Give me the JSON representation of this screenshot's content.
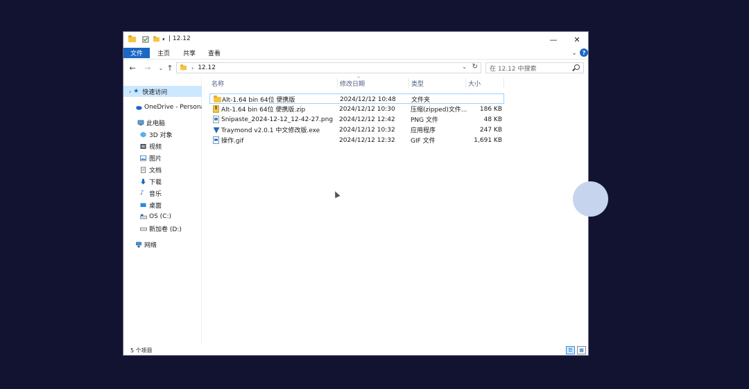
{
  "window": {
    "title": "12.12",
    "title_sep": "|",
    "close": "✕",
    "minimize": "—",
    "ribbon_collapse": "⌄",
    "help": "?"
  },
  "ribbon": {
    "tabs": [
      {
        "label": "文件",
        "active": true
      },
      {
        "label": "主页",
        "active": false
      },
      {
        "label": "共享",
        "active": false
      },
      {
        "label": "查看",
        "active": false
      }
    ]
  },
  "nav": {
    "back": "←",
    "forward": "→",
    "recent": "⌄",
    "up": "↑",
    "path_sep": "›",
    "path": "12.12",
    "path_dropdown": "⌄",
    "refresh": "↻",
    "search_placeholder": "在 12.12 中搜索"
  },
  "sidebar": {
    "items": [
      {
        "label": "快速访问",
        "icon": "star-icon",
        "selected": true
      },
      {
        "label": "OneDrive - Persona",
        "icon": "cloud-icon",
        "selected": false
      },
      {
        "label": "此电脑",
        "icon": "computer-icon",
        "selected": false
      },
      {
        "label": "3D 对象",
        "icon": "cube-icon",
        "selected": false
      },
      {
        "label": "视频",
        "icon": "video-icon",
        "selected": false
      },
      {
        "label": "图片",
        "icon": "picture-icon",
        "selected": false
      },
      {
        "label": "文档",
        "icon": "document-icon",
        "selected": false
      },
      {
        "label": "下载",
        "icon": "download-icon",
        "selected": false
      },
      {
        "label": "音乐",
        "icon": "music-icon",
        "selected": false
      },
      {
        "label": "桌面",
        "icon": "desktop-icon",
        "selected": false
      },
      {
        "label": "OS (C:)",
        "icon": "drive-icon",
        "selected": false
      },
      {
        "label": "新加卷 (D:)",
        "icon": "drive-icon",
        "selected": false
      },
      {
        "label": "网络",
        "icon": "network-icon",
        "selected": false
      }
    ]
  },
  "columns": {
    "name": "名称",
    "date": "修改日期",
    "type": "类型",
    "size": "大小",
    "sort_indicator": "^"
  },
  "files": [
    {
      "name": "Alt-1.64 bin 64位 便携版",
      "date": "2024/12/12 10:48",
      "type": "文件夹",
      "size": "",
      "icon": "folder-icon",
      "selected": true
    },
    {
      "name": "Alt-1.64 bin 64位 便携版.zip",
      "date": "2024/12/12 10:30",
      "type": "压缩(zipped)文件...",
      "size": "186 KB",
      "icon": "zip-icon",
      "selected": false
    },
    {
      "name": "Snipaste_2024-12-12_12-42-27.png",
      "date": "2024/12/12 12:42",
      "type": "PNG 文件",
      "size": "48 KB",
      "icon": "png-icon",
      "selected": false
    },
    {
      "name": "Traymond v2.0.1 中文修改版.exe",
      "date": "2024/12/12 10:32",
      "type": "应用程序",
      "size": "247 KB",
      "icon": "exe-icon",
      "selected": false
    },
    {
      "name": "操作.gif",
      "date": "2024/12/12 12:32",
      "type": "GIF 文件",
      "size": "1,691 KB",
      "icon": "gif-icon",
      "selected": false
    }
  ],
  "status": {
    "item_count": "5 个项目"
  },
  "colors": {
    "background": "#121231",
    "accent": "#1a67c4",
    "selection": "#cce8ff",
    "header_text": "#4d6082"
  }
}
